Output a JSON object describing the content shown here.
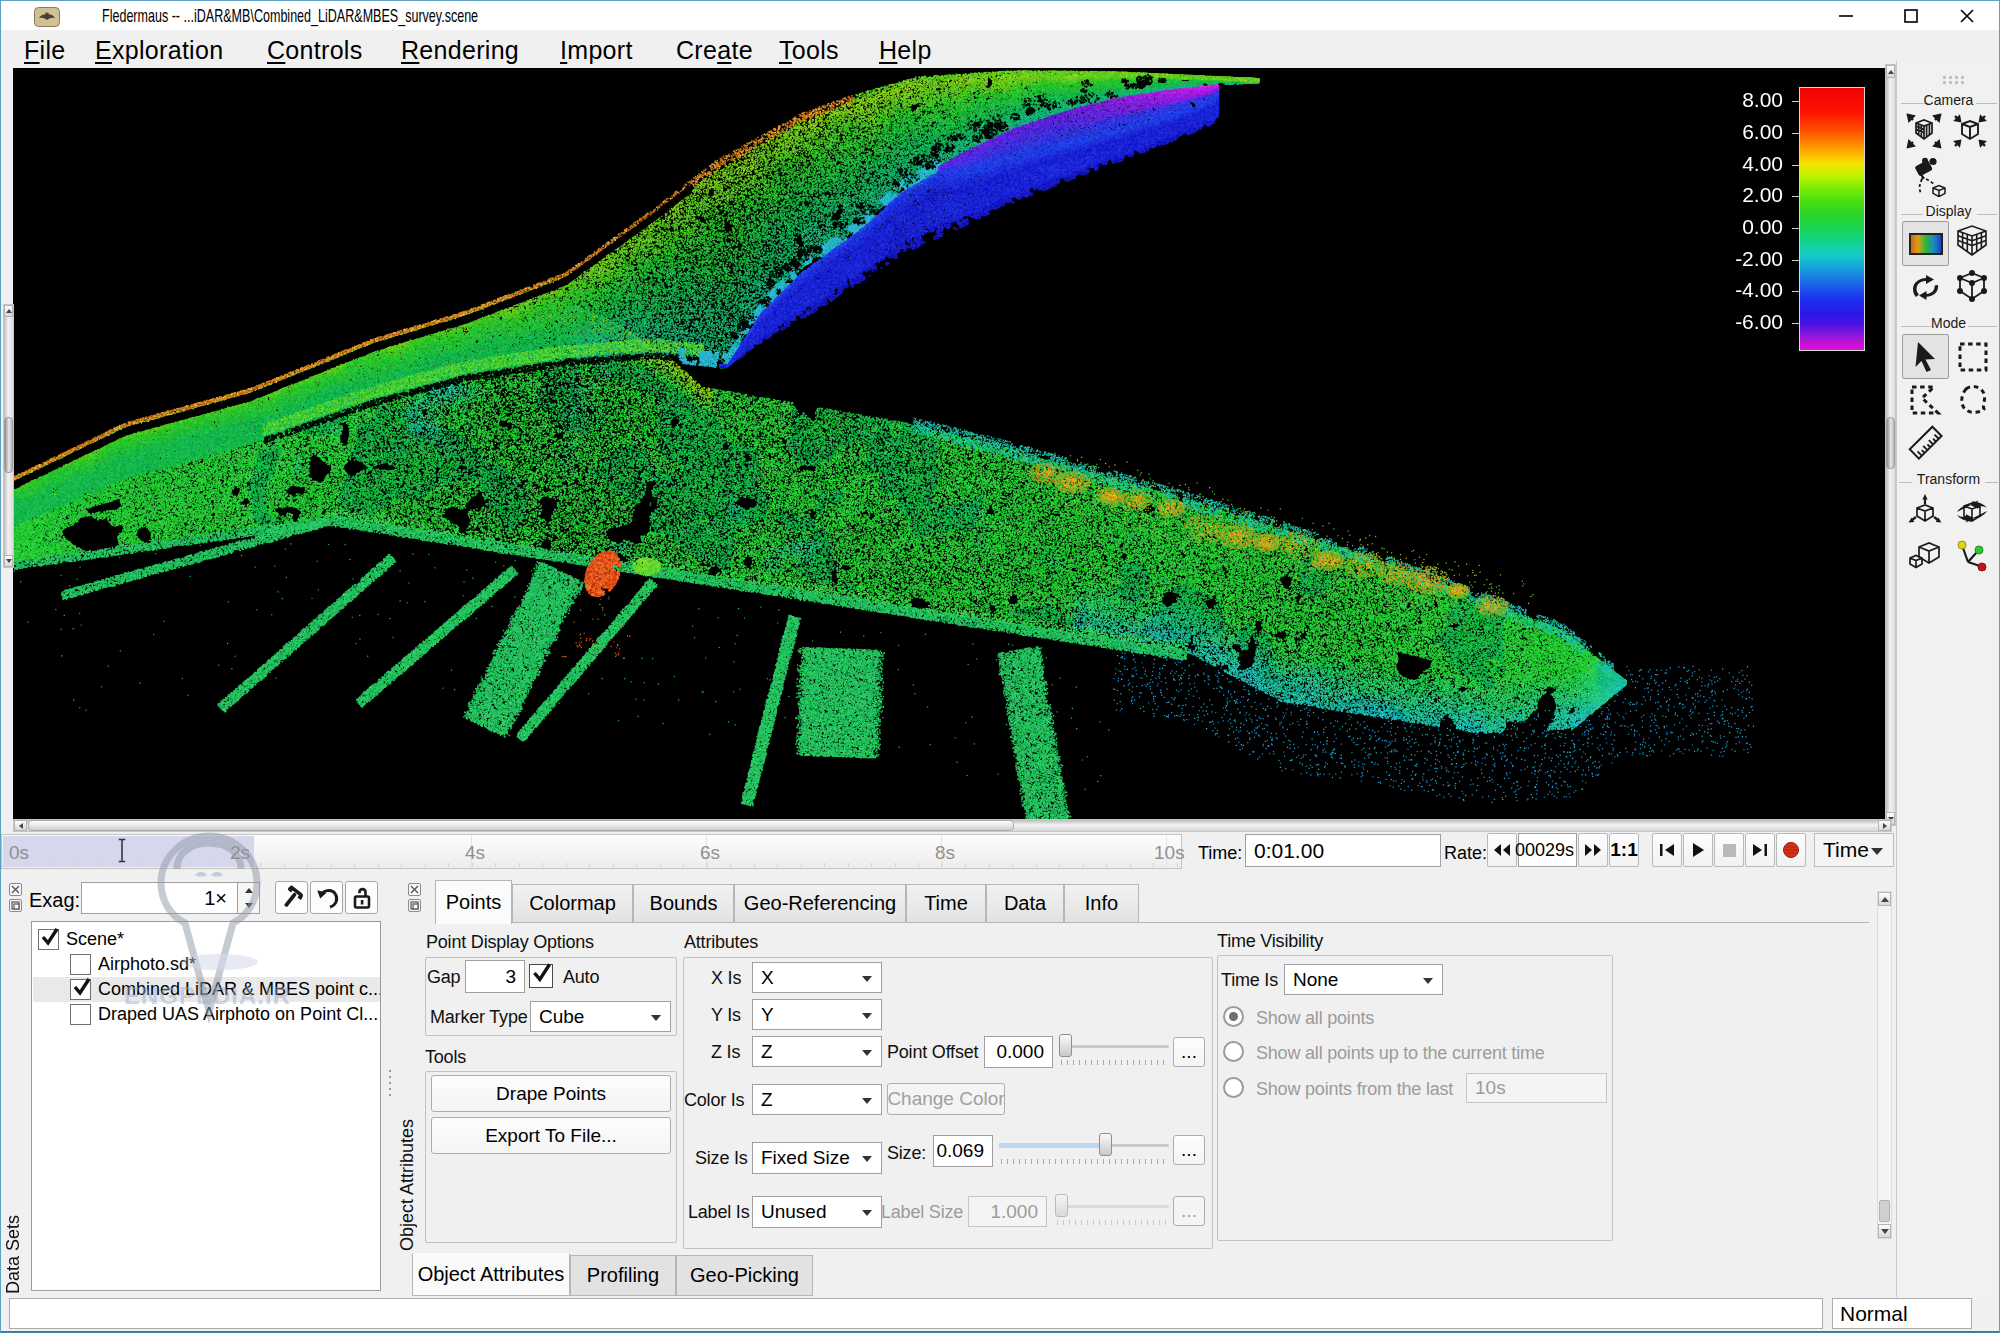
{
  "window": {
    "title": "Fledermaus -- ...iDAR&MB\\Combined_LiDAR&MBES_survey.scene",
    "controls": {
      "minimize": "minimize",
      "maximize": "maximize",
      "close": "close"
    }
  },
  "menu": {
    "items": [
      {
        "pre": "",
        "u": "F",
        "post": "ile"
      },
      {
        "pre": "",
        "u": "E",
        "post": "xploration"
      },
      {
        "pre": "",
        "u": "C",
        "post": "ontrols"
      },
      {
        "pre": "",
        "u": "R",
        "post": "endering"
      },
      {
        "pre": "",
        "u": "I",
        "post": "mport"
      },
      {
        "pre": "Cre",
        "u": "a",
        "post": "te"
      },
      {
        "pre": "",
        "u": "T",
        "post": "ools"
      },
      {
        "pre": "",
        "u": "H",
        "post": "elp"
      }
    ]
  },
  "legend": {
    "labels": [
      "8.00",
      "6.00",
      "4.00",
      "2.00",
      "0.00",
      "-2.00",
      "-4.00",
      "-6.00"
    ]
  },
  "toolbar": {
    "sections": [
      "Camera",
      "Display",
      "Mode",
      "Transform"
    ]
  },
  "timeline": {
    "ticks": [
      "0s",
      "2s",
      "4s",
      "6s",
      "8s",
      "10s"
    ],
    "time_label": "Time:",
    "time_value": "0:01.00",
    "rate_label": "Rate:",
    "rate_value": "00029s",
    "ratio": "1:1",
    "mode": "Time"
  },
  "datasets": {
    "exag_label": "Exag:",
    "exag_value": "1×",
    "tab": "Data Sets",
    "tree": [
      {
        "label": "Scene*",
        "checked": true,
        "selected": false
      },
      {
        "label": "Airphoto.sd*",
        "checked": false,
        "selected": false
      },
      {
        "label": "Combined LiDAR & MBES point c...",
        "checked": true,
        "selected": true
      },
      {
        "label": "Draped UAS Airphoto on Point Cl...",
        "checked": false,
        "selected": false
      }
    ]
  },
  "attributes": {
    "side_label": "Object Attributes",
    "tabs": [
      "Points",
      "Colormap",
      "Bounds",
      "Geo-Referencing",
      "Time",
      "Data",
      "Info"
    ],
    "selected_tab": "Points",
    "point_display": {
      "title": "Point Display Options",
      "gap_label": "Gap",
      "gap_value": "3",
      "auto_label": "Auto",
      "auto_checked": true,
      "marker_label": "Marker Type",
      "marker_value": "Cube"
    },
    "tools": {
      "title": "Tools",
      "drape": "Drape Points",
      "export": "Export To File..."
    },
    "attrs": {
      "title": "Attributes",
      "x_label": "X Is",
      "x_value": "X",
      "y_label": "Y Is",
      "y_value": "Y",
      "z_label": "Z Is",
      "z_value": "Z",
      "offset_label": "Point Offset",
      "offset_value": "0.000",
      "color_label": "Color Is",
      "color_value": "Z",
      "change_color": "Change Color",
      "size_label": "Size Is",
      "size_value": "Fixed Size",
      "size2_label": "Size:",
      "size2_value": "0.069",
      "label_label": "Label Is",
      "label_value": "Unused",
      "labelsize_label": "Label Size",
      "labelsize_value": "1.000",
      "dots": "..."
    },
    "time_visibility": {
      "title": "Time Visibility",
      "timeis_label": "Time Is",
      "timeis_value": "None",
      "radio1": "Show all points",
      "radio2": "Show all points up to the current time",
      "radio3": "Show points from the last",
      "last_value": "10s"
    },
    "bottom_tabs": [
      "Object Attributes",
      "Profiling",
      "Geo-Picking"
    ]
  },
  "statusbar": {
    "field": "",
    "mode": "Normal"
  },
  "watermark": {
    "text": "ENGPEDIA.IR"
  },
  "viewport": {
    "scene": {
      "palette": {
        "crest": [
          "#c06a14",
          "#d8821c",
          "#e09428",
          "#b85c10",
          "#e8c040"
        ],
        "face_hi": "#9ad416",
        "face_mid": "#2cc828",
        "face_lo": "#16b84e",
        "face_teal": "#16b098",
        "green1": "#22c832",
        "green2": "#2ad23a",
        "green3": "#14bc50",
        "bright": "#3ce24a",
        "teal": "#16c49e",
        "cyan": "#1fc2d6",
        "cyan2": "#2fb4e4",
        "blue_core": "#1a1ed2",
        "blue_edge": "#2340e8",
        "blue_dark": "#1414a8",
        "purple": "#7c18da",
        "magenta": "#cc22e8",
        "blob_y": "#ddc018",
        "blob_o": "#e29018",
        "boat": [
          "#e04818",
          "#f06024",
          "#c83010",
          "#e88030"
        ],
        "pier": "#28ca5e",
        "pier2": "#20ba6e"
      }
    }
  }
}
